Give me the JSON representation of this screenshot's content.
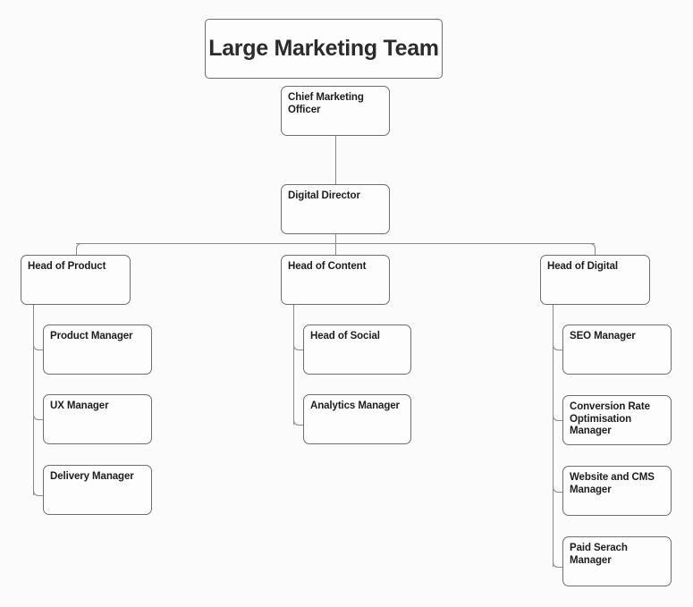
{
  "diagram": {
    "title": "Large Marketing Team",
    "nodes": {
      "cmo": "Chief Marketing Officer",
      "digital_director": "Digital Director",
      "head_of_product": "Head of Product",
      "head_of_content": "Head of Content",
      "head_of_digital": "Head of Digital",
      "product_manager": "Product Manager",
      "ux_manager": "UX Manager",
      "delivery_manager": "Delivery Manager",
      "head_of_social": "Head of Social",
      "analytics_manager": "Analytics Manager",
      "seo_manager": "SEO Manager",
      "cro_manager": "Conversion Rate Optimisation Manager",
      "website_cms_manager": "Website and CMS Manager",
      "paid_search_manager": "Paid Serach Manager"
    },
    "colors": {
      "background": "#fbfbfb",
      "node_fill": "#fdfdfd",
      "node_border": "#6e6e6e",
      "connector": "#8a8a8a",
      "text": "#1d1d1d",
      "title_text": "#2b2b2b"
    }
  }
}
